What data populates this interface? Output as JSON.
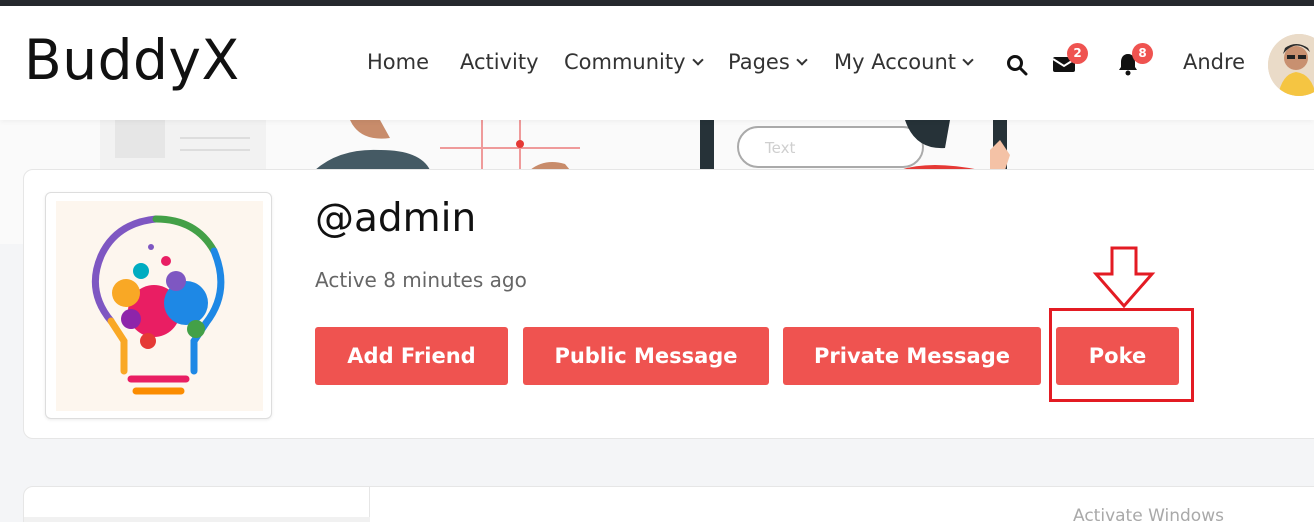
{
  "site": {
    "logo": "BuddyX"
  },
  "nav": {
    "items": [
      {
        "label": "Home"
      },
      {
        "label": "Activity"
      },
      {
        "label": "Community"
      },
      {
        "label": "Pages"
      },
      {
        "label": "My Account"
      }
    ],
    "messages_count": "2",
    "notifications_count": "8",
    "username": "Andre",
    "icons": [
      "search-icon",
      "envelope-icon",
      "bell-icon"
    ]
  },
  "cover": {
    "placeholder_text": "Text"
  },
  "profile": {
    "handle": "@admin",
    "status": "Active 8 minutes ago",
    "buttons": [
      {
        "label": "Add Friend"
      },
      {
        "label": "Public Message"
      },
      {
        "label": "Private Message"
      },
      {
        "label": "Poke"
      }
    ]
  },
  "watermark": "Activate Windows",
  "colors": {
    "accent": "#ef5350",
    "highlight": "#e31b23",
    "badge": "#ef5350"
  }
}
